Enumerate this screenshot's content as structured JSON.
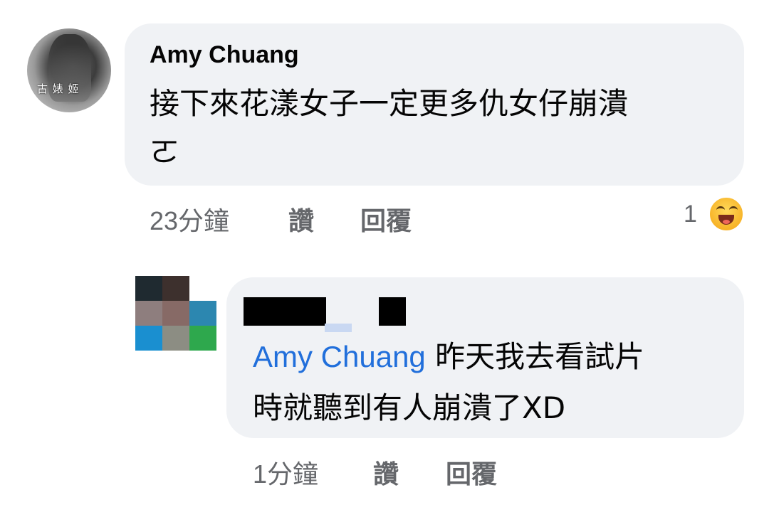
{
  "comment": {
    "author": "Amy Chuang",
    "avatar_watermark": "古 婊 姬",
    "text_line1": "接下來花漾女子一定更多仇女仔崩潰",
    "text_line2": "ㄛ",
    "time": "23分鐘",
    "like_label": "讚",
    "reply_label": "回覆",
    "reaction_count": "1",
    "reaction_icon": "haha-emoji-icon"
  },
  "reply": {
    "mention": "Amy Chuang",
    "text_line1": "昨天我去看試片",
    "text_line2": "時就聽到有人崩潰了XD",
    "time": "1分鐘",
    "like_label": "讚",
    "reply_label": "回覆"
  },
  "colors": {
    "bubble": "#f0f2f5",
    "meta": "#65676b",
    "mention": "#216fdb"
  }
}
